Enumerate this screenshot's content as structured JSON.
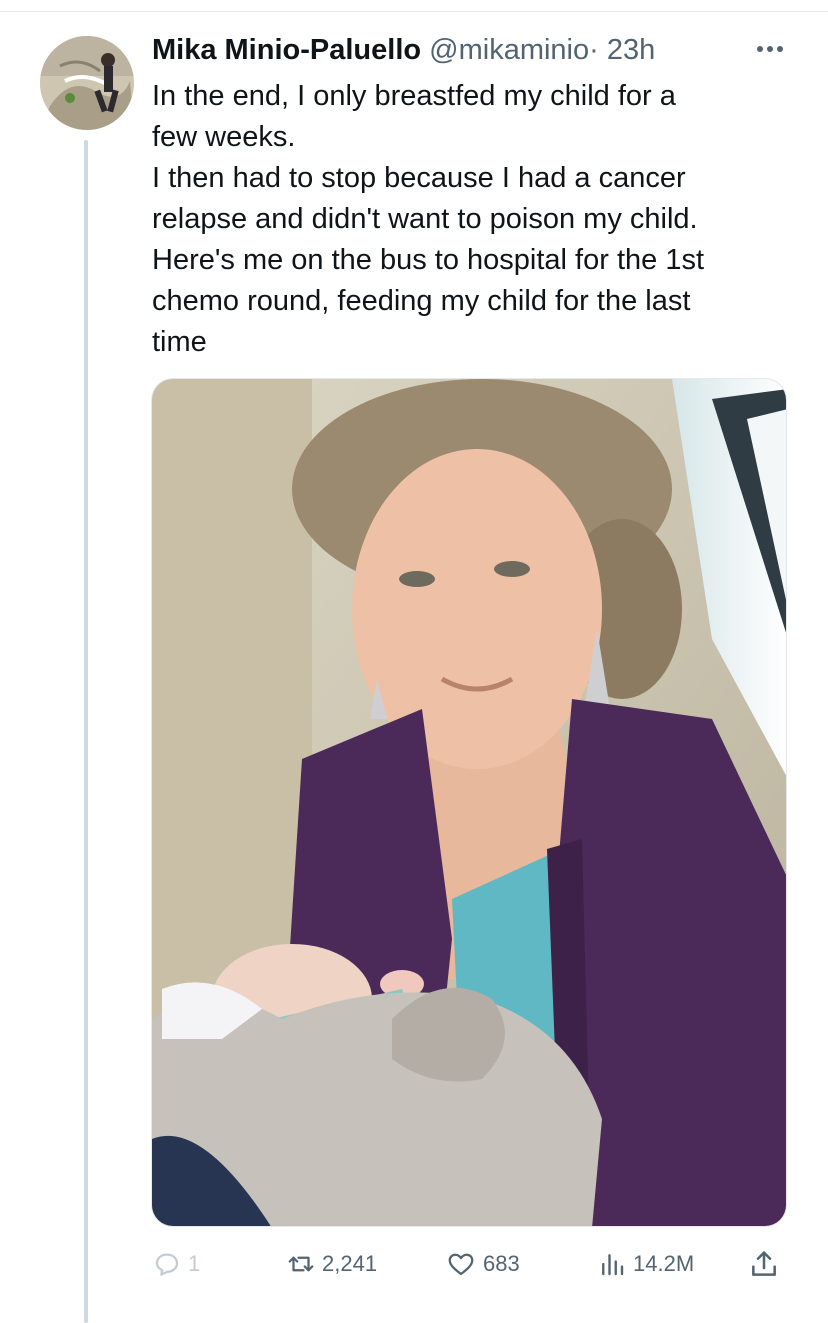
{
  "tweet": {
    "display_name": "Mika Minio-Paluello",
    "handle": "@mikaminio",
    "separator": "·",
    "time": "23h",
    "text": "In the end, I only breastfed my child for a\nfew weeks.\nI then had to stop because I had a cancer\nrelapse and didn't want to poison my child.\nHere's me on the bus to hospital for the 1st\nchemo round, feeding my child for the last\ntime"
  },
  "actions": {
    "replies": "1",
    "retweets": "2,241",
    "likes": "683",
    "views": "14.2M"
  },
  "icons": {
    "more": "more-dots-icon",
    "reply": "reply-bubble-icon",
    "retweet": "retweet-arrows-icon",
    "like": "heart-icon",
    "views": "views-bars-icon",
    "share": "share-upload-icon"
  },
  "colors": {
    "text": "#0f1419",
    "secondary": "#536471",
    "thread_line": "#cfd9de",
    "cardigan": "#4b2a5a",
    "top": "#5fb8c4"
  }
}
